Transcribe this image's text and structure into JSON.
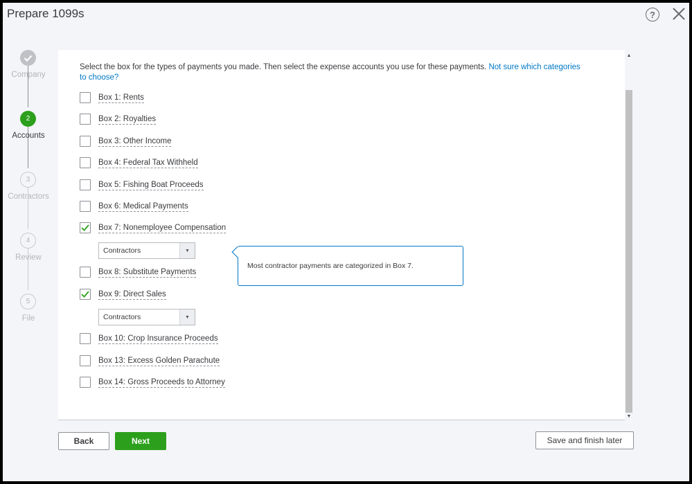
{
  "window": {
    "title": "Prepare 1099s"
  },
  "steps": [
    {
      "label": "Company",
      "number": "",
      "state": "done"
    },
    {
      "label": "Accounts",
      "number": "2",
      "state": "active"
    },
    {
      "label": "Contractors",
      "number": "3",
      "state": "pending"
    },
    {
      "label": "Review",
      "number": "4",
      "state": "pending"
    },
    {
      "label": "File",
      "number": "5",
      "state": "pending"
    }
  ],
  "intro": {
    "text": "Select the box for the types of payments you made. Then select the expense accounts you use for these payments. ",
    "link": "Not sure which categories to choose?"
  },
  "boxes": [
    {
      "label": "Box 1: Rents",
      "checked": false
    },
    {
      "label": "Box 2: Royalties",
      "checked": false
    },
    {
      "label": "Box 3: Other Income",
      "checked": false
    },
    {
      "label": "Box 4: Federal Tax Withheld",
      "checked": false
    },
    {
      "label": "Box 5: Fishing Boat Proceeds",
      "checked": false
    },
    {
      "label": "Box 6: Medical Payments",
      "checked": false
    },
    {
      "label": "Box 7: Nonemployee Compensation",
      "checked": true,
      "account": "Contractors"
    },
    {
      "label": "Box 8: Substitute Payments",
      "checked": false
    },
    {
      "label": "Box 9: Direct Sales",
      "checked": true,
      "account": "Contractors"
    },
    {
      "label": "Box 10: Crop Insurance Proceeds",
      "checked": false
    },
    {
      "label": "Box 13: Excess Golden Parachute",
      "checked": false
    },
    {
      "label": "Box 14: Gross Proceeds to Attorney",
      "checked": false
    }
  ],
  "tooltip": {
    "text": "Most contractor payments are categorized in Box 7."
  },
  "footer": {
    "back": "Back",
    "next": "Next",
    "save": "Save and finish later"
  },
  "help_symbol": "?",
  "colors": {
    "accent_green": "#2ca01c",
    "link_blue": "#0077c5"
  },
  "icons": {
    "help": "question-circle-icon",
    "close": "close-icon",
    "check": "checkmark-icon"
  }
}
